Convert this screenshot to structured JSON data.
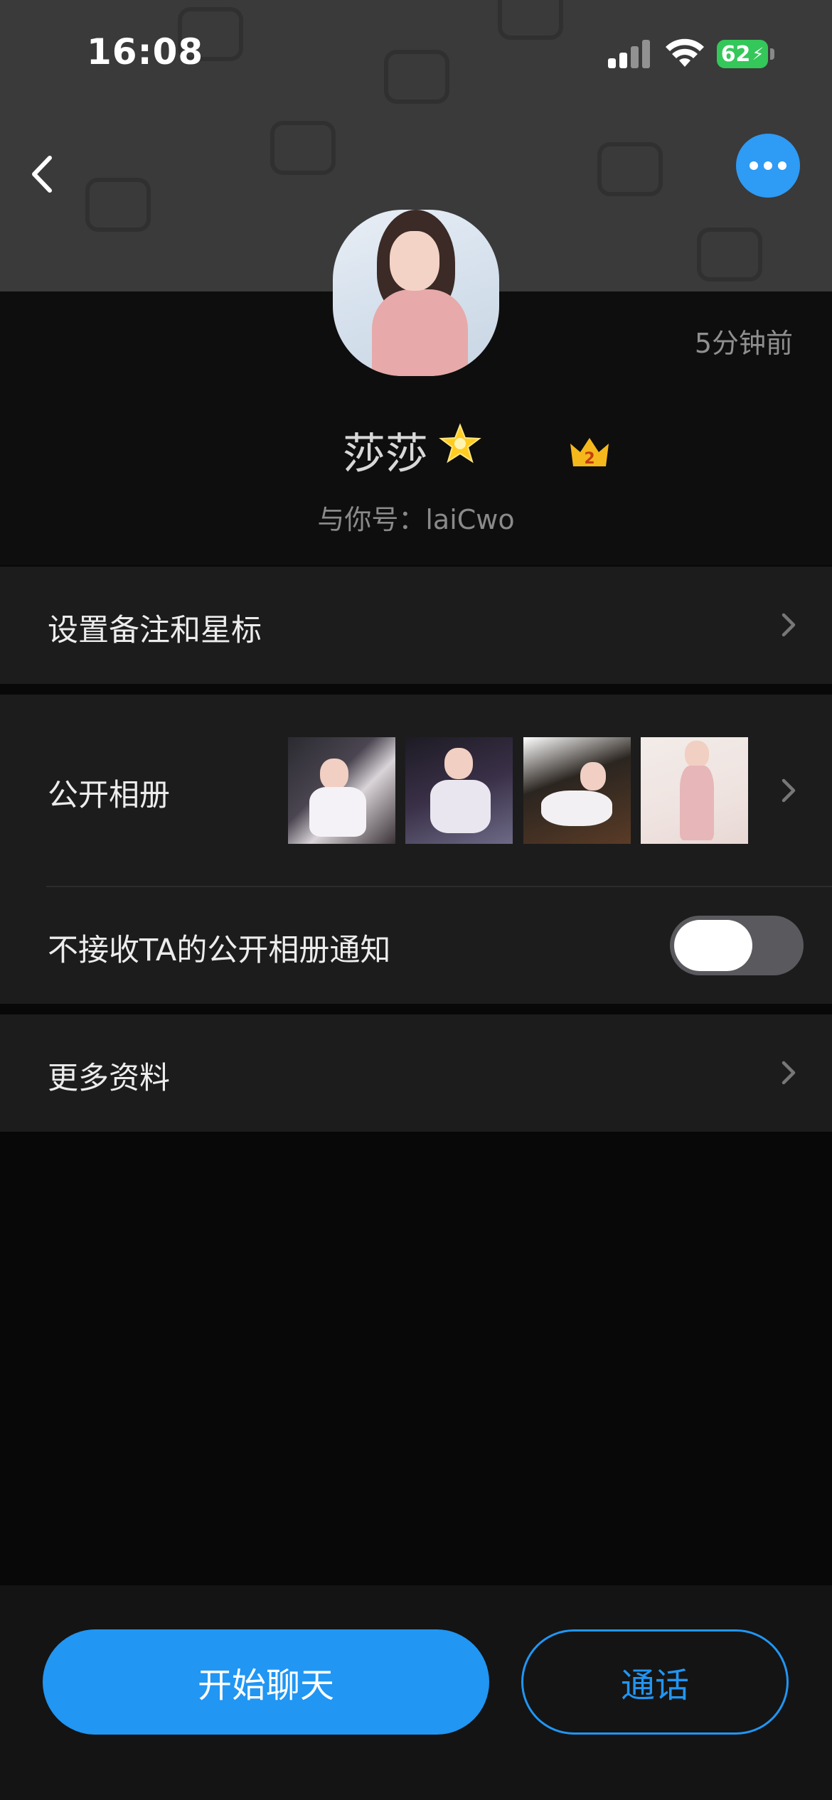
{
  "status_bar": {
    "time": "16:08",
    "battery_percent": "62",
    "icons": [
      "signal-icon",
      "wifi-icon",
      "battery-charging-icon"
    ]
  },
  "nav": {
    "back_icon": "chevron-left-icon",
    "more_icon": "more-horizontal-icon"
  },
  "profile": {
    "name": "莎莎",
    "name_emoji_icon": "glowing-star-icon",
    "badge_icon": "crown-icon",
    "badge_level": "2",
    "last_seen": "5分钟前",
    "sub_id": "与你号：laiCwo"
  },
  "rows": {
    "remark": {
      "label": "设置备注和星标"
    },
    "album": {
      "label": "公开相册",
      "thumbnail_count": 4
    },
    "album_notify": {
      "label": "不接收TA的公开相册通知",
      "enabled": false
    },
    "more_info": {
      "label": "更多资料"
    }
  },
  "actions": {
    "chat_label": "开始聊天",
    "call_label": "通话"
  },
  "colors": {
    "accent": "#2196f3",
    "header_bg": "#3a3a3a",
    "card_bg": "#1c1c1c",
    "page_bg": "#080808",
    "battery_green": "#34c759"
  }
}
